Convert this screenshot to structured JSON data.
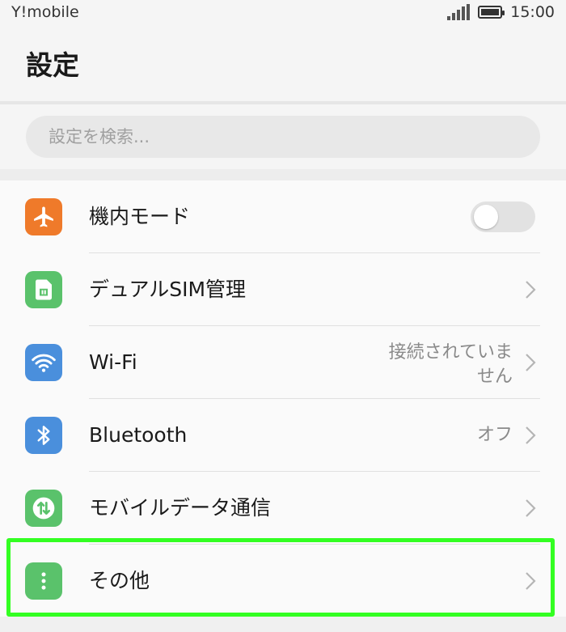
{
  "status_bar": {
    "carrier": "Y!mobile",
    "time": "15:00",
    "icons": [
      "signal-icon",
      "battery-icon"
    ]
  },
  "header": {
    "title": "設定"
  },
  "search": {
    "placeholder": "設定を検索..."
  },
  "colors": {
    "airplane": "#ef7a2a",
    "dual_sim": "#5ac26b",
    "wifi": "#4a8fdc",
    "bluetooth": "#4a8fdc",
    "mobile_data": "#5ac26b",
    "other": "#5ac26b",
    "highlight": "#33ff22"
  },
  "settings": {
    "items": [
      {
        "label": "機内モード",
        "icon": "airplane-icon",
        "toggle": false
      },
      {
        "label": "デュアルSIM管理",
        "icon": "sim-card-icon"
      },
      {
        "label": "Wi-Fi",
        "icon": "wifi-icon",
        "value": "接続されていません"
      },
      {
        "label": "Bluetooth",
        "icon": "bluetooth-icon",
        "value": "オフ"
      },
      {
        "label": "モバイルデータ通信",
        "icon": "mobile-data-icon"
      },
      {
        "label": "その他",
        "icon": "more-vertical-icon"
      }
    ]
  }
}
